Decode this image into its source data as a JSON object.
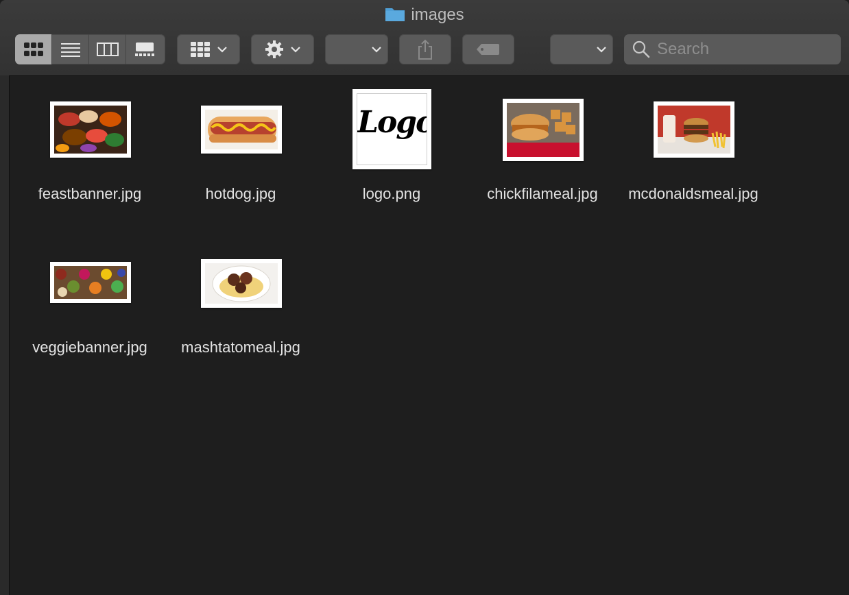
{
  "window": {
    "title": "images",
    "folder_color": "#5aa9de"
  },
  "toolbar": {
    "view_modes": [
      "icon-view",
      "list-view",
      "column-view",
      "gallery-view"
    ],
    "active_view": "icon-view",
    "search_placeholder": "Search"
  },
  "files": [
    {
      "name": "feastbanner.jpg"
    },
    {
      "name": "hotdog.jpg"
    },
    {
      "name": "logo.png",
      "logo_text": "Logo"
    },
    {
      "name": "chickfilameal.jpg"
    },
    {
      "name": "mcdonaldsmeal.jpg"
    },
    {
      "name": "veggiebanner.jpg"
    },
    {
      "name": "mashtatomeal.jpg"
    }
  ]
}
